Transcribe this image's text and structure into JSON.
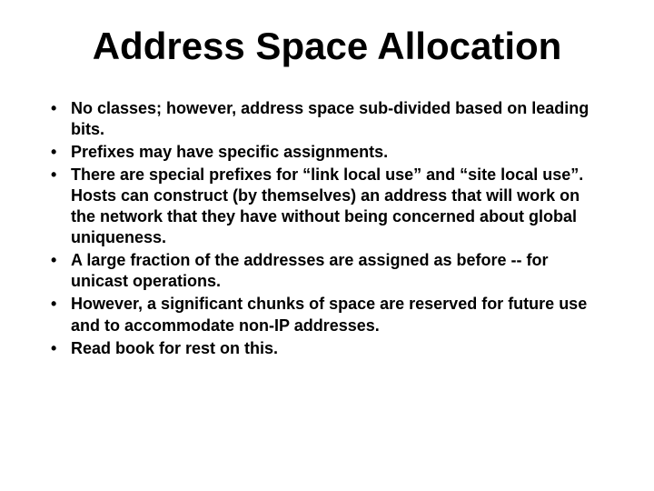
{
  "slide": {
    "title": "Address Space Allocation",
    "bullets": [
      "No classes; however, address space sub-divided based on leading bits.",
      "Prefixes may have specific assignments.",
      "There are special prefixes for “link local use” and “site local use”. Hosts can construct (by themselves) an address that will work on the network that they have without being concerned about global uniqueness.",
      "A large fraction of the addresses are assigned as before -- for unicast operations.",
      "However, a significant chunks of space are reserved for future use and to accommodate non-IP addresses.",
      "Read book for rest on this."
    ]
  }
}
